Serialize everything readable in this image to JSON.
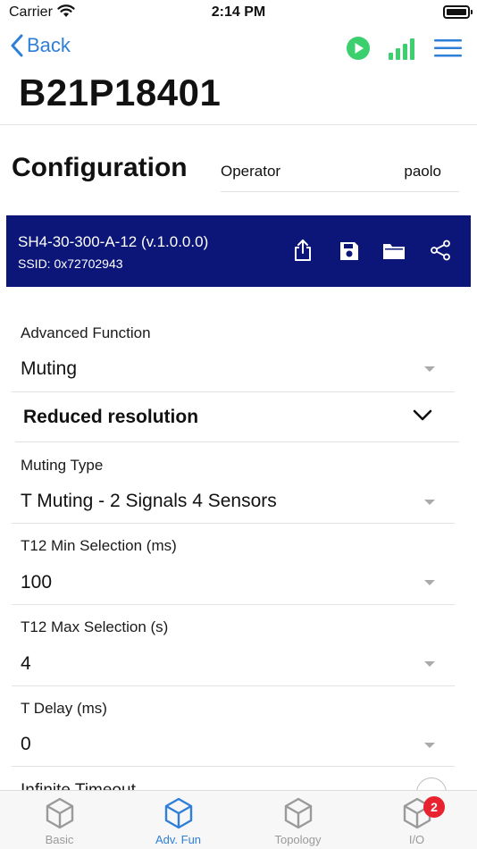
{
  "status_bar": {
    "carrier": "Carrier",
    "time": "2:14 PM"
  },
  "nav": {
    "back_label": "Back",
    "icons": [
      "play-icon",
      "signal-icon",
      "menu-icon"
    ]
  },
  "device": {
    "title": "B21P18401"
  },
  "configuration": {
    "title": "Configuration",
    "operator_label": "Operator",
    "operator_value": "paolo"
  },
  "device_card": {
    "name": "SH4-30-300-A-12 (v.1.0.0.0)",
    "ssid": "SSID: 0x72702943",
    "background": "#0c1678",
    "icons": [
      "export-icon",
      "save-icon",
      "folder-icon",
      "share-icon"
    ]
  },
  "advanced_function": {
    "label": "Advanced Function",
    "value": "Muting"
  },
  "reduced_resolution": {
    "label": "Reduced resolution"
  },
  "fields": [
    {
      "label": "Muting Type",
      "value": "T Muting - 2 Signals 4 Sensors"
    },
    {
      "label": "T12 Min Selection (ms)",
      "value": "100"
    },
    {
      "label": "T12 Max Selection (s)",
      "value": "4"
    },
    {
      "label": "T Delay (ms)",
      "value": "0"
    }
  ],
  "partial_row": {
    "label": "Infinite Timeout"
  },
  "tabs": [
    {
      "label": "Basic",
      "active": false
    },
    {
      "label": "Adv. Fun",
      "active": true
    },
    {
      "label": "Topology",
      "active": false
    },
    {
      "label": "I/O",
      "active": false,
      "badge": "2"
    }
  ],
  "colors": {
    "accent": "#2f7fd8",
    "play": "#3ccf6e",
    "badge": "#e8222e"
  }
}
